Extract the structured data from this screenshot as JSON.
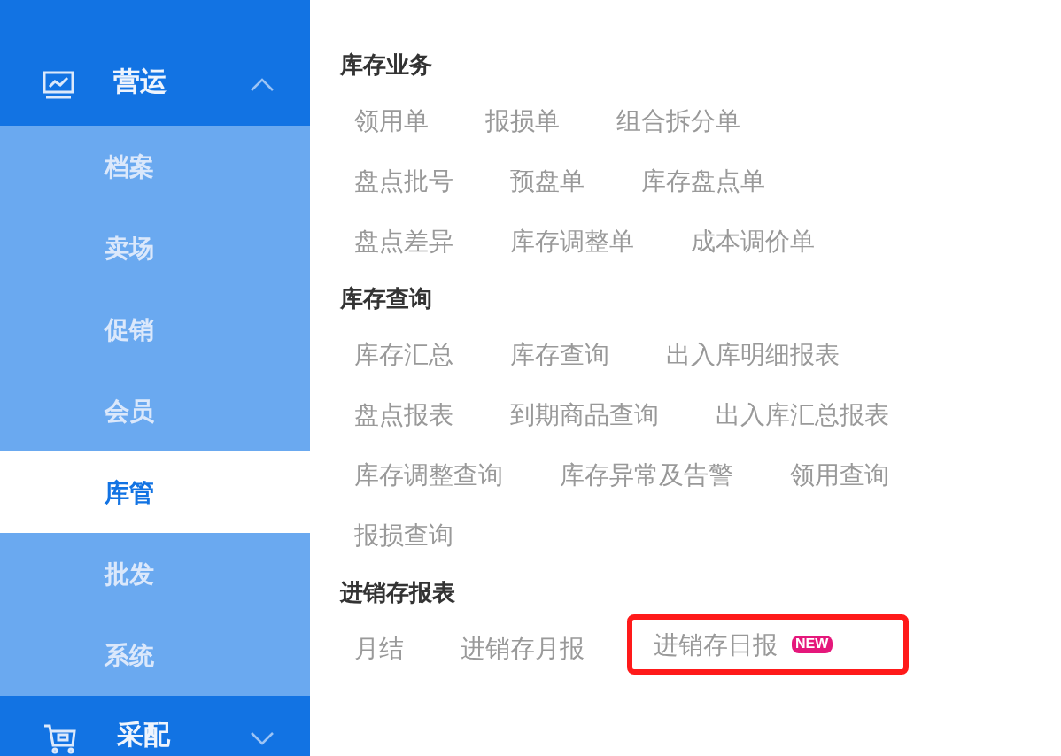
{
  "sidebar": {
    "groups": [
      {
        "label": "营运",
        "kind": "chart",
        "expanded": true,
        "children": [
          {
            "label": "档案",
            "selected": false
          },
          {
            "label": "卖场",
            "selected": false
          },
          {
            "label": "促销",
            "selected": false
          },
          {
            "label": "会员",
            "selected": false
          },
          {
            "label": "库管",
            "selected": true
          },
          {
            "label": "批发",
            "selected": false
          },
          {
            "label": "系统",
            "selected": false
          }
        ]
      },
      {
        "label": "采配",
        "kind": "cart",
        "expanded": false
      }
    ]
  },
  "sections": [
    {
      "title": "库存业务",
      "rows": [
        [
          {
            "label": "领用单",
            "highlighted": false
          },
          {
            "label": "报损单",
            "highlighted": false
          },
          {
            "label": "组合拆分单",
            "highlighted": false
          }
        ],
        [
          {
            "label": "盘点批号",
            "highlighted": false
          },
          {
            "label": "预盘单",
            "highlighted": false
          },
          {
            "label": "库存盘点单",
            "highlighted": false
          }
        ],
        [
          {
            "label": "盘点差异",
            "highlighted": false
          },
          {
            "label": "库存调整单",
            "highlighted": false
          },
          {
            "label": "成本调价单",
            "highlighted": false
          }
        ]
      ]
    },
    {
      "title": "库存查询",
      "rows": [
        [
          {
            "label": "库存汇总",
            "highlighted": false
          },
          {
            "label": "库存查询",
            "highlighted": false
          },
          {
            "label": "出入库明细报表",
            "highlighted": false
          }
        ],
        [
          {
            "label": "盘点报表",
            "highlighted": false
          },
          {
            "label": "到期商品查询",
            "highlighted": false
          },
          {
            "label": "出入库汇总报表",
            "highlighted": false
          }
        ],
        [
          {
            "label": "库存调整查询",
            "highlighted": false
          },
          {
            "label": "库存异常及告警",
            "highlighted": false
          },
          {
            "label": "领用查询",
            "highlighted": false
          }
        ],
        [
          {
            "label": "报损查询",
            "highlighted": false
          }
        ]
      ]
    },
    {
      "title": "进销存报表",
      "rows": [
        [
          {
            "label": "月结",
            "highlighted": false
          },
          {
            "label": "进销存月报",
            "highlighted": false
          },
          {
            "label": "进销存日报",
            "highlighted": true,
            "badge": "NEW"
          }
        ]
      ]
    }
  ]
}
